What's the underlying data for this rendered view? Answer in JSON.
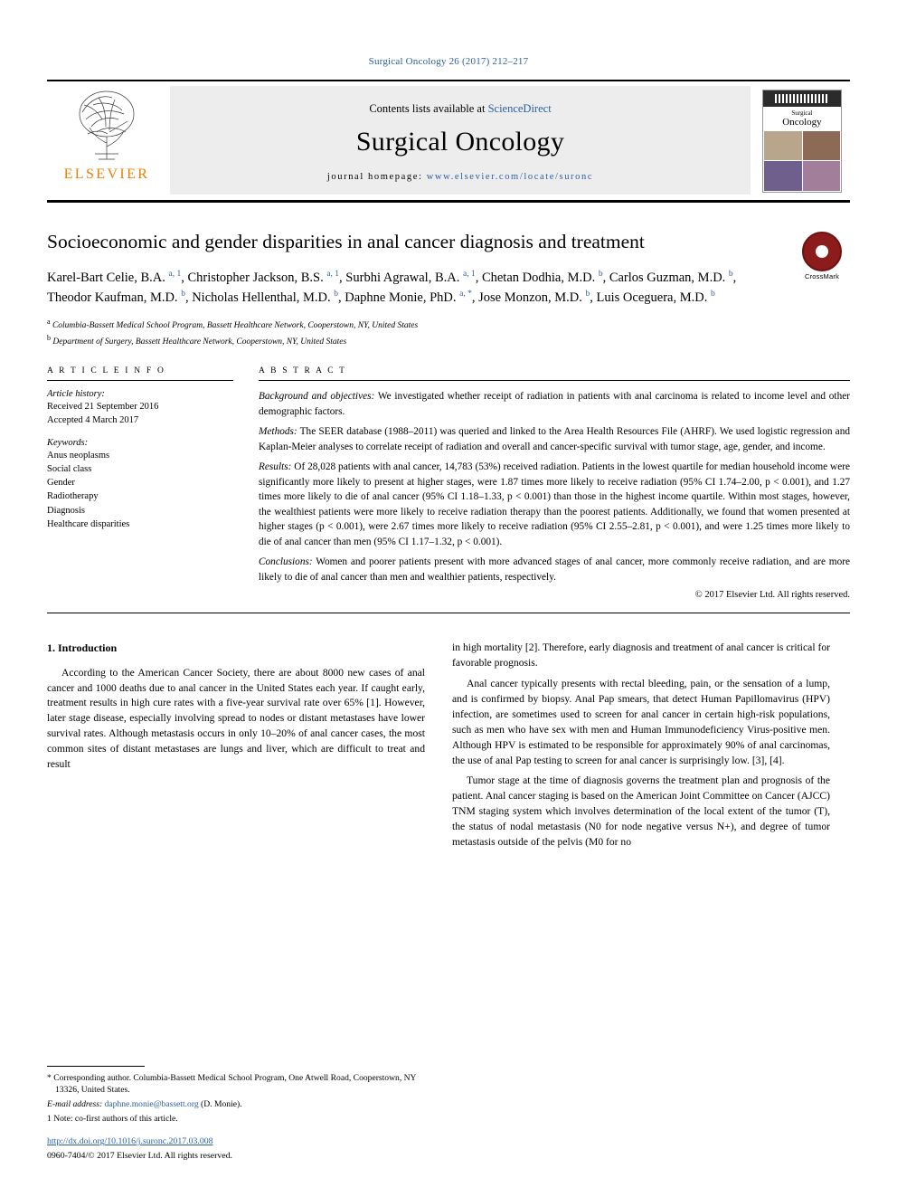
{
  "running_head": "Surgical Oncology 26 (2017) 212–217",
  "masthead": {
    "publisher_name": "ELSEVIER",
    "contents_prefix": "Contents lists available at ",
    "contents_link": "ScienceDirect",
    "journal_name": "Surgical Oncology",
    "homepage_prefix": "journal homepage: ",
    "homepage_url": "www.elsevier.com/locate/suronc",
    "cover_small_title": "Surgical",
    "cover_big_title": "Oncology"
  },
  "crossmark": {
    "label": "CrossMark"
  },
  "title": "Socioeconomic and gender disparities in anal cancer diagnosis and treatment",
  "authors_html": "Karel-Bart Celie, B.A. <sup class=\"aff\">a, 1</sup>, Christopher Jackson, B.S. <sup class=\"aff\">a, 1</sup>, Surbhi Agrawal, B.A. <sup class=\"aff\">a, 1</sup>, Chetan Dodhia, M.D. <sup class=\"aff\">b</sup>, Carlos Guzman, M.D. <sup class=\"aff\">b</sup>, Theodor Kaufman, M.D. <sup class=\"aff\">b</sup>, Nicholas Hellenthal, M.D. <sup class=\"aff\">b</sup>, Daphne Monie, PhD. <sup class=\"aff\">a, *</sup>, Jose Monzon, M.D. <sup class=\"aff\">b</sup>, Luis Oceguera, M.D. <sup class=\"aff\">b</sup>",
  "affiliations": [
    "a Columbia-Bassett Medical School Program, Bassett Healthcare Network, Cooperstown, NY, United States",
    "b Department of Surgery, Bassett Healthcare Network, Cooperstown, NY, United States"
  ],
  "article_info": {
    "heading": "A R T I C L E   I N F O",
    "history_label": "Article history:",
    "history": [
      "Received 21 September 2016",
      "Accepted 4 March 2017"
    ],
    "keywords_label": "Keywords:",
    "keywords": [
      "Anus neoplasms",
      "Social class",
      "Gender",
      "Radiotherapy",
      "Diagnosis",
      "Healthcare disparities"
    ]
  },
  "abstract": {
    "heading": "A B S T R A C T",
    "paragraphs": [
      {
        "lead": "Background and objectives:",
        "text": " We investigated whether receipt of radiation in patients with anal carcinoma is related to income level and other demographic factors."
      },
      {
        "lead": "Methods:",
        "text": " The SEER database (1988–2011) was queried and linked to the Area Health Resources File (AHRF). We used logistic regression and Kaplan-Meier analyses to correlate receipt of radiation and overall and cancer-specific survival with tumor stage, age, gender, and income."
      },
      {
        "lead": "Results:",
        "text": " Of 28,028 patients with anal cancer, 14,783 (53%) received radiation. Patients in the lowest quartile for median household income were significantly more likely to present at higher stages, were 1.87 times more likely to receive radiation (95% CI 1.74–2.00, p < 0.001), and 1.27 times more likely to die of anal cancer (95% CI 1.18–1.33, p < 0.001) than those in the highest income quartile. Within most stages, however, the wealthiest patients were more likely to receive radiation therapy than the poorest patients. Additionally, we found that women presented at higher stages (p < 0.001), were 2.67 times more likely to receive radiation (95% CI 2.55–2.81, p < 0.001), and were 1.25 times more likely to die of anal cancer than men (95% CI 1.17–1.32, p < 0.001)."
      },
      {
        "lead": "Conclusions:",
        "text": " Women and poorer patients present with more advanced stages of anal cancer, more commonly receive radiation, and are more likely to die of anal cancer than men and wealthier patients, respectively."
      }
    ],
    "copyright": "© 2017 Elsevier Ltd. All rights reserved."
  },
  "body": {
    "section_title": "1.  Introduction",
    "left_paragraphs": [
      "According to the American Cancer Society, there are about 8000 new cases of anal cancer and 1000 deaths due to anal cancer in the United States each year. If caught early, treatment results in high cure rates with a five-year survival rate over 65% [1]. However, later stage disease, especially involving spread to nodes or distant metastases have lower survival rates. Although metastasis occurs in only 10–20% of anal cancer cases, the most common sites of distant metastases are lungs and liver, which are difficult to treat and result"
    ],
    "right_paragraphs": [
      "in high mortality [2]. Therefore, early diagnosis and treatment of anal cancer is critical for favorable prognosis.",
      "Anal cancer typically presents with rectal bleeding, pain, or the sensation of a lump, and is confirmed by biopsy. Anal Pap smears, that detect Human Papillomavirus (HPV) infection, are sometimes used to screen for anal cancer in certain high-risk populations, such as men who have sex with men and Human Immunodeficiency Virus-positive men. Although HPV is estimated to be responsible for approximately 90% of anal carcinomas, the use of anal Pap testing to screen for anal cancer is surprisingly low. [3], [4].",
      "Tumor stage at the time of diagnosis governs the treatment plan and prognosis of the patient. Anal cancer staging is based on the American Joint Committee on Cancer (AJCC) TNM staging system which involves determination of the local extent of the tumor (T), the status of nodal metastasis (N0 for node negative versus N+), and degree of tumor metastasis outside of the pelvis (M0 for no"
    ]
  },
  "footnotes": {
    "corresponding": "* Corresponding author. Columbia-Bassett Medical School Program, One Atwell Road, Cooperstown, NY 13326, United States.",
    "email_label": "E-mail address: ",
    "email": "daphne.monie@bassett.org",
    "email_suffix": " (D. Monie).",
    "note": "1  Note: co-first authors of this article.",
    "doi": "http://dx.doi.org/10.1016/j.suronc.2017.03.008",
    "issn": "0960-7404/© 2017 Elsevier Ltd. All rights reserved."
  }
}
